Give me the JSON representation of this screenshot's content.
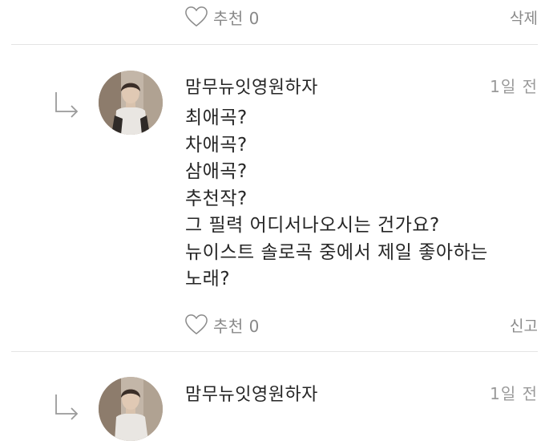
{
  "top_item": {
    "like_label": "추천",
    "like_count": "0",
    "action_label": "삭제"
  },
  "comments": [
    {
      "author": "맘무뉴잇영원하자",
      "time": "1일 전",
      "lines": [
        "최애곡?",
        "차애곡?",
        "삼애곡?",
        "추천작?",
        "그 필력 어디서나오시는 건가요?",
        "뉴이스트 솔로곡 중에서 제일 좋아하는",
        "노래?"
      ],
      "like_label": "추천",
      "like_count": "0",
      "action_label": "신고"
    },
    {
      "author": "맘무뉴잇영원하자",
      "time": "1일 전"
    }
  ],
  "icons": {
    "heart": "heart-icon",
    "reply": "reply-arrow-icon",
    "avatar": "avatar"
  },
  "colors": {
    "text": "#262626",
    "muted": "#8a8a8a",
    "divider": "#e4e4e4"
  }
}
